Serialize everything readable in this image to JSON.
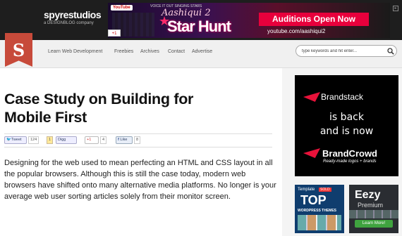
{
  "header": {
    "logo_name": "spyrestudios",
    "logo_sub": "a DESIGNBLOG company",
    "ribbon_letter": "S",
    "ad": {
      "youtube": "YouTube",
      "small": "VOICE IT OUT SINGING STARS",
      "script": "Aashiqui 2",
      "big": "Star Hunt",
      "button": "Auditions Open Now",
      "url": "youtube.com/aashiqui2"
    },
    "gplus": "+1"
  },
  "nav": {
    "items": [
      "Learn Web Development",
      "Freebies",
      "Archives",
      "Contact",
      "Advertise"
    ],
    "search_placeholder": "type keywords and hit enter..."
  },
  "article": {
    "title_line1": "Case Study on Building for",
    "title_line2": "Mobile First",
    "share": {
      "tweet": "Tweet",
      "tweet_count": "124",
      "digg_count": "1",
      "digg": "Digg",
      "gplus": "+1",
      "gplus_count": "4",
      "like": "Like",
      "like_count": "8"
    },
    "body": "Designing for the web used to mean perfecting an HTML and CSS layout in all the popular browsers. Although this is still the case today, modern web browsers have shifted onto many alternative media platforms. No longer is your average web user sorting articles solely from their monitor screen."
  },
  "sidebar": {
    "ad1": {
      "brand": "Brandstack",
      "line1": "is back",
      "line2": "and is now",
      "brand2": "BrandCrowd",
      "tagline": "Ready-made logos + brands"
    },
    "ad2": {
      "template": "Template",
      "sold": "SOLD",
      "top": "TOP",
      "wp": "WORDPRESS THEMES"
    },
    "ad3": {
      "name": "Eezy",
      "premium": "Premium",
      "button": "Learn More!"
    }
  },
  "colors": {
    "topbar": "#1e1e1e",
    "ribbon": "#c74a3a",
    "accent_red": "#e8003c"
  }
}
